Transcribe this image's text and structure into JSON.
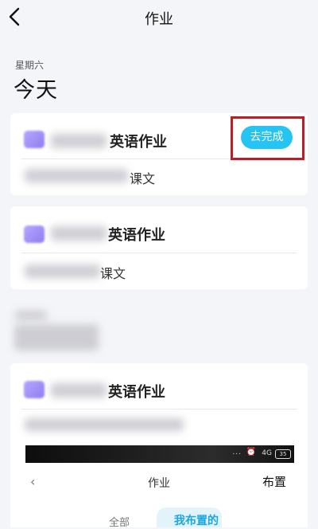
{
  "header": {
    "title": "作业"
  },
  "today_section": {
    "weekday": "星期六",
    "day_label": "今天"
  },
  "cards": [
    {
      "title_suffix": "英语作业",
      "desc_suffix": "课文",
      "action_label": "去完成"
    },
    {
      "title_suffix": "英语作业",
      "desc_suffix": "课文"
    },
    {
      "title_suffix": "英语作业"
    }
  ],
  "overlay": {
    "status": {
      "battery": "35",
      "dots": "...",
      "alarm": "⏰",
      "signal": "4G"
    },
    "title": "作业",
    "assign_label": "布置",
    "tabs": {
      "all": "全部",
      "mine": "我布置的"
    }
  },
  "colors": {
    "accent": "#26c4f2",
    "highlight_box": "#b3212b",
    "icon_purple": "#9c8af5"
  }
}
